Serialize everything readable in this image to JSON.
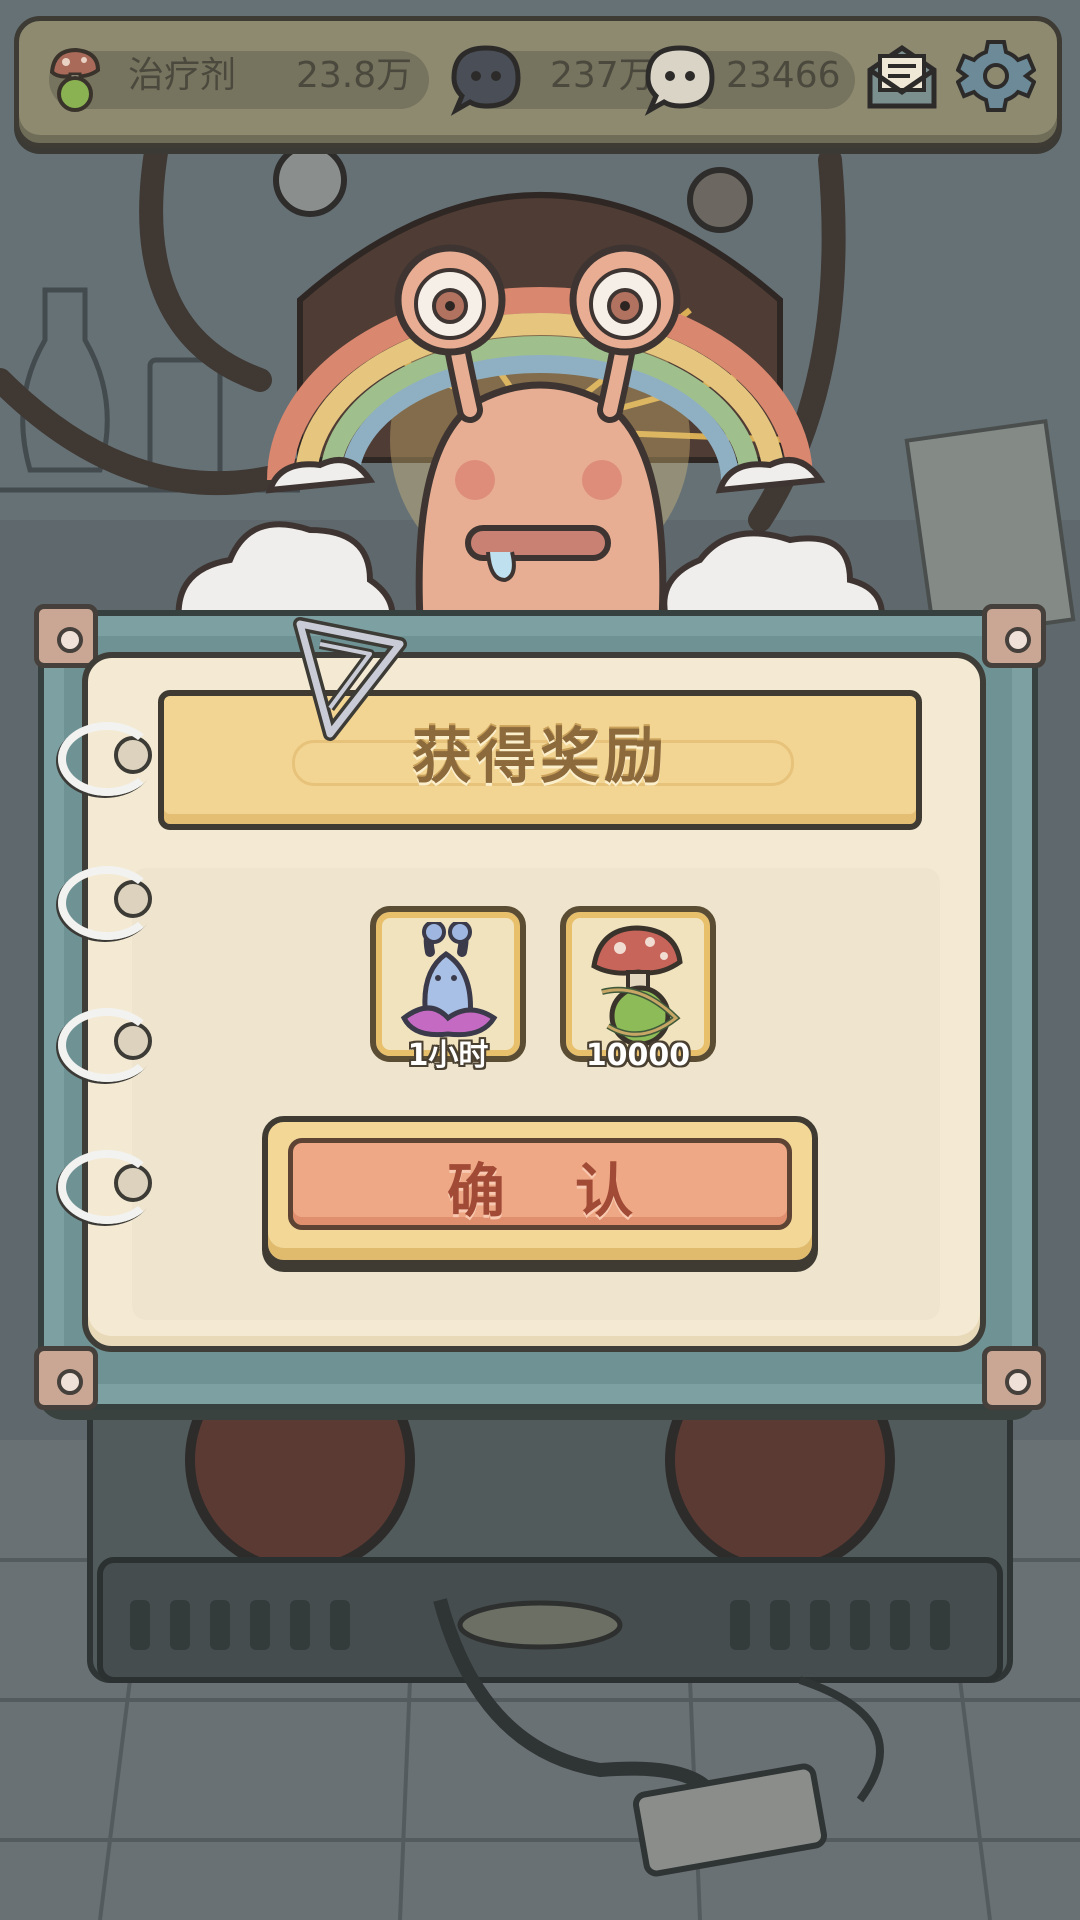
{
  "topbar": {
    "potion": {
      "label": "治疗剂",
      "value": "23.8万",
      "icon": "potion-icon"
    },
    "black_bubble": {
      "value": "237万",
      "icon": "dark-chat-bubble-icon"
    },
    "white_bubble": {
      "value": "23466",
      "icon": "light-chat-bubble-icon"
    },
    "mail_icon": "mail-icon",
    "settings_icon": "gear-icon"
  },
  "dialog": {
    "title": "获得奖励",
    "rewards": [
      {
        "label": "1小时",
        "icon": "snail-bottle-icon"
      },
      {
        "label": "10000",
        "icon": "mushroom-potion-icon"
      }
    ],
    "confirm_label": "确认"
  },
  "colors": {
    "paper": "#f4ead3",
    "banner": "#f3d593",
    "confirm": "#eea885",
    "frame": "#7da0a2"
  }
}
